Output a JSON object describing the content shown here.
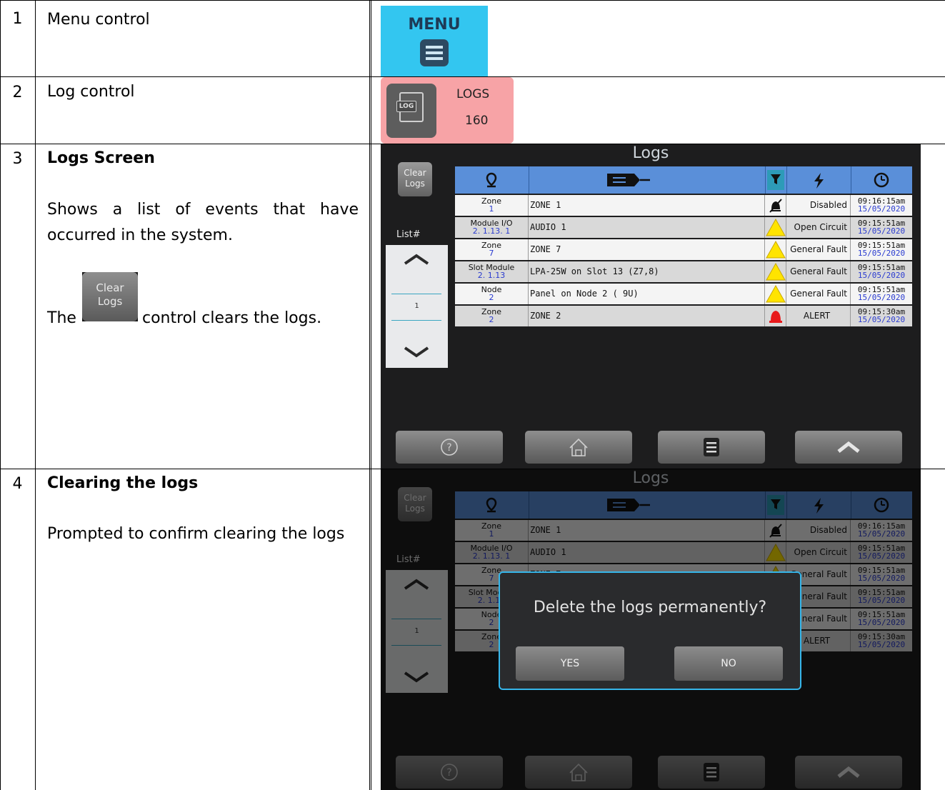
{
  "rows": [
    {
      "num": "1",
      "text": "Menu control"
    },
    {
      "num": "2",
      "text": "Log control"
    },
    {
      "num": "3",
      "heading": "Logs Screen",
      "para": "Shows a list of events that have occurred in the system.",
      "pre": "The",
      "post": "control clears the logs."
    },
    {
      "num": "4",
      "heading": "Clearing the logs",
      "para": "Prompted to confirm clearing the logs"
    }
  ],
  "menu_button": {
    "label": "MENU",
    "icon": "hamburger-icon"
  },
  "log_button": {
    "icon_text": "LOG",
    "label": "LOGS",
    "count": "160"
  },
  "inline_clear": {
    "line1": "Clear",
    "line2": "Logs"
  },
  "logs_screen": {
    "title": "Logs",
    "clear_line1": "Clear",
    "clear_line2": "Logs",
    "list_label": "List#",
    "page": "1",
    "header_icons": [
      "location-pin-icon",
      "tag-icon",
      "filter-clear-icon",
      "lightning-icon",
      "clock-icon"
    ],
    "entries": [
      {
        "type": "Zone",
        "sub": "1",
        "name": "ZONE 1",
        "icon": "muted-bell-icon",
        "status": "Disabled",
        "time": "09:16:15am",
        "date": "15/05/2020"
      },
      {
        "type": "Module I/O",
        "sub": "2. 1.13. 1",
        "name": "AUDIO 1",
        "icon": "warning-icon",
        "status": "Open Circuit",
        "time": "09:15:51am",
        "date": "15/05/2020"
      },
      {
        "type": "Zone",
        "sub": "7",
        "name": "ZONE 7",
        "icon": "warning-icon",
        "status": "General Fault",
        "time": "09:15:51am",
        "date": "15/05/2020"
      },
      {
        "type": "Slot Module",
        "sub": "2. 1.13",
        "name": "LPA-25W on Slot 13 (Z7,8)",
        "icon": "warning-icon",
        "status": "General Fault",
        "time": "09:15:51am",
        "date": "15/05/2020"
      },
      {
        "type": "Node",
        "sub": "2",
        "name": "Panel on Node 2 ( 9U)",
        "icon": "warning-icon",
        "status": "General Fault",
        "time": "09:15:51am",
        "date": "15/05/2020"
      },
      {
        "type": "Zone",
        "sub": "2",
        "name": "ZONE 2",
        "icon": "alert-bell-icon",
        "status": "ALERT",
        "time": "09:15:30am",
        "date": "15/05/2020"
      }
    ],
    "bottom_buttons": [
      "help-icon",
      "home-icon",
      "menu-icon",
      "chevron-up-icon"
    ]
  },
  "confirm_dialog": {
    "question": "Delete the logs permanently?",
    "yes": "YES",
    "no": "NO"
  }
}
